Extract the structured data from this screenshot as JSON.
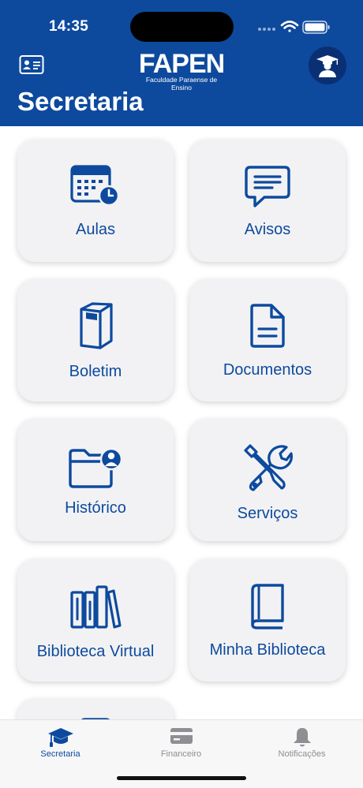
{
  "status": {
    "time": "14:35"
  },
  "header": {
    "logo_text": "FAPEN",
    "logo_subtitle": "Faculdade Paraense de Ensino",
    "title": "Secretaria"
  },
  "cards": [
    {
      "label": "Aulas",
      "icon": "calendar-clock-icon"
    },
    {
      "label": "Avisos",
      "icon": "chat-bubble-icon"
    },
    {
      "label": "Boletim",
      "icon": "notebook-icon"
    },
    {
      "label": "Documentos",
      "icon": "document-icon"
    },
    {
      "label": "Histórico",
      "icon": "folder-user-icon"
    },
    {
      "label": "Serviços",
      "icon": "tools-icon"
    },
    {
      "label": "Biblioteca Virtual",
      "icon": "books-icon"
    },
    {
      "label": "Minha Biblioteca",
      "icon": "book-icon"
    }
  ],
  "tabs": [
    {
      "label": "Secretaria",
      "icon": "graduation-cap-icon",
      "active": true
    },
    {
      "label": "Financeiro",
      "icon": "credit-card-icon",
      "active": false
    },
    {
      "label": "Notificações",
      "icon": "bell-icon",
      "active": false
    }
  ],
  "colors": {
    "brand": "#0d4a9e",
    "card_bg": "#f2f2f4",
    "tab_active": "#0d4a9e",
    "tab_inactive": "#8e8e93"
  }
}
